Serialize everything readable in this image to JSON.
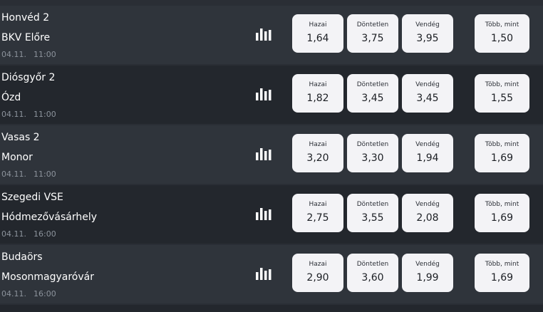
{
  "matches": [
    {
      "home_team": "Honvéd 2",
      "away_team": "BKV Előre",
      "date": "04.11.",
      "time": "11:00",
      "odds": [
        {
          "label": "Hazai",
          "value": "1,64"
        },
        {
          "label": "Döntetlen",
          "value": "3,75"
        },
        {
          "label": "Vendég",
          "value": "3,95"
        },
        {
          "label": "Több, mint",
          "value": "1,50"
        }
      ]
    },
    {
      "home_team": "Diósgyőr 2",
      "away_team": "Ózd",
      "date": "04.11.",
      "time": "11:00",
      "odds": [
        {
          "label": "Hazai",
          "value": "1,82"
        },
        {
          "label": "Döntetlen",
          "value": "3,45"
        },
        {
          "label": "Vendég",
          "value": "3,45"
        },
        {
          "label": "Több, mint",
          "value": "1,55"
        }
      ]
    },
    {
      "home_team": "Vasas 2",
      "away_team": "Monor",
      "date": "04.11.",
      "time": "11:00",
      "odds": [
        {
          "label": "Hazai",
          "value": "3,20"
        },
        {
          "label": "Döntetlen",
          "value": "3,30"
        },
        {
          "label": "Vendég",
          "value": "1,94"
        },
        {
          "label": "Több, mint",
          "value": "1,69"
        }
      ]
    },
    {
      "home_team": "Szegedi VSE",
      "away_team": "Hódmezővásárhely",
      "date": "04.11.",
      "time": "16:00",
      "odds": [
        {
          "label": "Hazai",
          "value": "2,75"
        },
        {
          "label": "Döntetlen",
          "value": "3,55"
        },
        {
          "label": "Vendég",
          "value": "2,08"
        },
        {
          "label": "Több, mint",
          "value": "1,69"
        }
      ]
    },
    {
      "home_team": "Budaörs",
      "away_team": "Mosonmagyaróvár",
      "date": "04.11.",
      "time": "16:00",
      "odds": [
        {
          "label": "Hazai",
          "value": "2,90"
        },
        {
          "label": "Döntetlen",
          "value": "3,60"
        },
        {
          "label": "Vendég",
          "value": "1,99"
        },
        {
          "label": "Több, mint",
          "value": "1,69"
        }
      ]
    }
  ],
  "icons": {
    "stats": "bar-chart-icon"
  },
  "colors": {
    "row_dark": "#23272d",
    "row_light": "#2f343b",
    "odd_button_bg": "#f3f3f6",
    "text_primary": "#ffffff",
    "text_muted": "#8c939c"
  }
}
